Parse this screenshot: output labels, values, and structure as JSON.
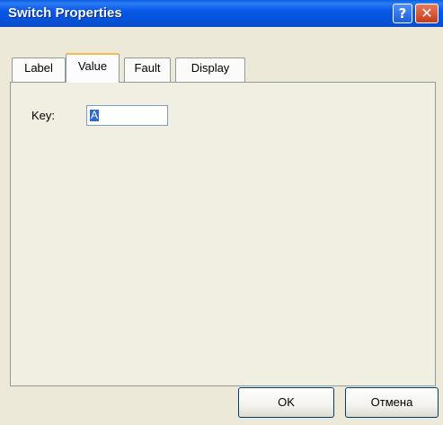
{
  "window": {
    "title": "Switch Properties",
    "help_glyph": "?",
    "close_glyph": "✕"
  },
  "tabs": [
    {
      "label": "Label",
      "active": false
    },
    {
      "label": "Value",
      "active": true
    },
    {
      "label": "Fault",
      "active": false
    },
    {
      "label": "Display",
      "active": false
    }
  ],
  "value_tab": {
    "key_label": "Key:",
    "key_value": "A"
  },
  "buttons": {
    "ok": "OK",
    "cancel": "Отмена"
  },
  "colors": {
    "titlebar": "#0652d9",
    "dialog_bg": "#ece9d8",
    "selection": "#316ac5",
    "active_tab_accent": "#f7b94b"
  }
}
